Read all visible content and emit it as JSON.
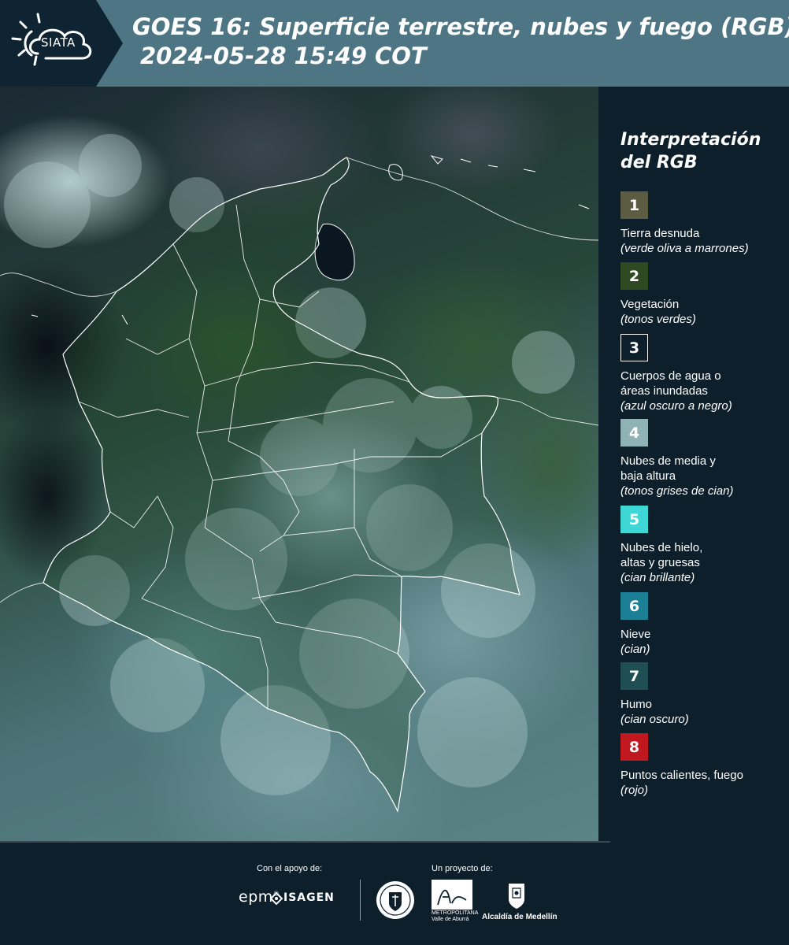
{
  "header": {
    "logo_text": "SIATA",
    "title_line1": "GOES 16: Superficie terrestre, nubes y fuego (RGB)",
    "title_line2": "2024-05-28 15:49 COT"
  },
  "legend": {
    "title": "Interpretación del RGB",
    "items": [
      {
        "number": "1",
        "label": "Tierra desnuda",
        "sub": "(verde oliva a marrones)",
        "color": "#5c5c42"
      },
      {
        "number": "2",
        "label": "Vegetación",
        "sub": "(tonos verdes)",
        "color": "#2e4a22"
      },
      {
        "number": "3",
        "label": "Cuerpos de agua o\náreas inundadas",
        "sub": "(azul oscuro a negro)",
        "color": "#0d1f2b"
      },
      {
        "number": "4",
        "label": "Nubes de media y\nbaja altura",
        "sub": "(tonos grises de cian)",
        "color": "#8fb2b4"
      },
      {
        "number": "5",
        "label": "Nubes de hielo,\naltas y gruesas",
        "sub": "(cian brillante)",
        "color": "#3fd6d6"
      },
      {
        "number": "6",
        "label": "Nieve",
        "sub": "(cian)",
        "color": "#1b7f95"
      },
      {
        "number": "7",
        "label": "Humo",
        "sub": "(cian oscuro)",
        "color": "#1f4e55"
      },
      {
        "number": "8",
        "label": "Puntos calientes, fuego",
        "sub": "(rojo)",
        "color": "#c0181e"
      }
    ]
  },
  "footer": {
    "support_label": "Con el apoyo de:",
    "project_label": "Un proyecto de:",
    "epm": "epm",
    "isagen": "ISAGEN",
    "area_name": "METROPOLITANA\nValle de Aburrá",
    "alcaldia": "Alcaldía de Medellín"
  }
}
